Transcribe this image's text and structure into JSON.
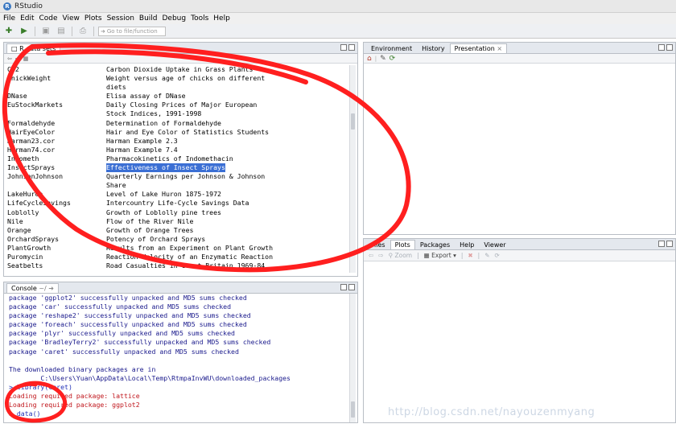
{
  "window": {
    "title": "RStudio"
  },
  "menu": [
    "File",
    "Edit",
    "Code",
    "View",
    "Plots",
    "Session",
    "Build",
    "Debug",
    "Tools",
    "Help"
  ],
  "toolbar": {
    "goto_placeholder": "Go to file/function"
  },
  "data_pane": {
    "tab": "R data sets",
    "rows": [
      {
        "name": "CO2",
        "desc": "Carbon Dioxide Uptake in Grass Plants"
      },
      {
        "name": "ChickWeight",
        "desc": "Weight versus age of chicks on different"
      },
      {
        "name": "",
        "desc": "diets"
      },
      {
        "name": "DNase",
        "desc": "Elisa assay of DNase"
      },
      {
        "name": "EuStockMarkets",
        "desc": "Daily Closing Prices of Major European"
      },
      {
        "name": "",
        "desc": "Stock Indices, 1991-1998"
      },
      {
        "name": "Formaldehyde",
        "desc": "Determination of Formaldehyde"
      },
      {
        "name": "HairEyeColor",
        "desc": "Hair and Eye Color of Statistics Students"
      },
      {
        "name": "Harman23.cor",
        "desc": "Harman Example 2.3"
      },
      {
        "name": "Harman74.cor",
        "desc": "Harman Example 7.4"
      },
      {
        "name": "Indometh",
        "desc": "Pharmacokinetics of Indomethacin"
      },
      {
        "name": "InsectSprays",
        "desc": "Effectiveness of Insect Sprays"
      },
      {
        "name": "JohnsonJohnson",
        "desc": "Quarterly Earnings per Johnson & Johnson"
      },
      {
        "name": "",
        "desc": "Share"
      },
      {
        "name": "LakeHuron",
        "desc": "Level of Lake Huron 1875-1972"
      },
      {
        "name": "LifeCycleSavings",
        "desc": "Intercountry Life-Cycle Savings Data"
      },
      {
        "name": "Loblolly",
        "desc": "Growth of Loblolly pine trees"
      },
      {
        "name": "Nile",
        "desc": "Flow of the River Nile"
      },
      {
        "name": "Orange",
        "desc": "Growth of Orange Trees"
      },
      {
        "name": "OrchardSprays",
        "desc": "Potency of Orchard Sprays"
      },
      {
        "name": "PlantGrowth",
        "desc": "Results from an Experiment on Plant Growth"
      },
      {
        "name": "Puromycin",
        "desc": "Reaction Velocity of an Enzymatic Reaction"
      },
      {
        "name": "Seatbelts",
        "desc": "Road Casualties in Great Britain 1969-84"
      }
    ],
    "highlighted_index": 11
  },
  "console": {
    "tab": "Console",
    "path": "~/",
    "lines": [
      {
        "text": "package 'ggplot2' successfully unpacked and MD5 sums checked",
        "type": "out"
      },
      {
        "text": "package 'car' successfully unpacked and MD5 sums checked",
        "type": "out"
      },
      {
        "text": "package 'reshape2' successfully unpacked and MD5 sums checked",
        "type": "out"
      },
      {
        "text": "package 'foreach' successfully unpacked and MD5 sums checked",
        "type": "out"
      },
      {
        "text": "package 'plyr' successfully unpacked and MD5 sums checked",
        "type": "out"
      },
      {
        "text": "package 'BradleyTerry2' successfully unpacked and MD5 sums checked",
        "type": "out"
      },
      {
        "text": "package 'caret' successfully unpacked and MD5 sums checked",
        "type": "out"
      },
      {
        "text": "",
        "type": "out"
      },
      {
        "text": "The downloaded binary packages are in",
        "type": "out"
      },
      {
        "text": "        C:\\Users\\Yuan\\AppData\\Local\\Temp\\RtmpaInvWU\\downloaded_packages",
        "type": "out"
      },
      {
        "text": "> library(caret)",
        "type": "prompt"
      },
      {
        "text": "Loading required package: lattice",
        "type": "red"
      },
      {
        "text": "Loading required package: ggplot2",
        "type": "red"
      },
      {
        "text": "> data()",
        "type": "prompt"
      }
    ]
  },
  "env_pane": {
    "tabs": [
      "Environment",
      "History",
      "Presentation"
    ],
    "active": "Presentation"
  },
  "files_pane": {
    "tabs": [
      "Files",
      "Plots",
      "Packages",
      "Help",
      "Viewer"
    ],
    "zoom_label": "Zoom",
    "export_label": "Export"
  },
  "watermark": "http://blog.csdn.net/nayouzenmyang",
  "colors": {
    "annotation_red": "#ff1f1f",
    "selection": "#3b6fd4"
  }
}
